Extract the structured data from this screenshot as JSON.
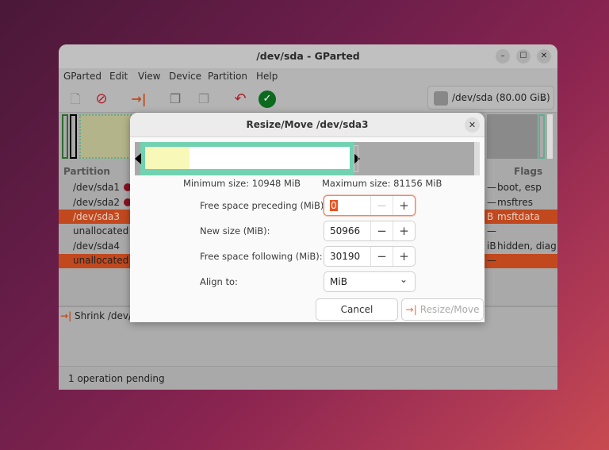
{
  "window": {
    "title": "/dev/sda - GParted",
    "controls": [
      "–",
      "☐",
      "✕"
    ]
  },
  "menu": [
    "GParted",
    "Edit",
    "View",
    "Device",
    "Partition",
    "Help"
  ],
  "toolbar": {
    "icons": [
      "new-partition-icon",
      "delete-icon",
      "resize-move-icon",
      "copy-icon",
      "paste-icon",
      "undo-icon",
      "apply-icon"
    ]
  },
  "device_selector": {
    "value": "/dev/sda (80.00 GiB)"
  },
  "table": {
    "headers": {
      "partition": "Partition",
      "flags": "Flags"
    },
    "rows": [
      {
        "partition": "/dev/sda1",
        "size_tail": "—",
        "flags": "boot, esp"
      },
      {
        "partition": "/dev/sda2",
        "size_tail": "—",
        "flags": "msftres"
      },
      {
        "partition": "/dev/sda3",
        "size_tail": "B",
        "flags": "msftdata",
        "selected": true
      },
      {
        "partition": "unallocated",
        "size_tail": "—",
        "flags": ""
      },
      {
        "partition": "/dev/sda4",
        "size_tail": "iB",
        "flags": "hidden, diag"
      },
      {
        "partition": "unallocated",
        "size_tail": "—",
        "flags": ""
      }
    ]
  },
  "operations": [
    "Shrink /dev/s"
  ],
  "status": "1 operation pending",
  "dialog": {
    "title": "Resize/Move /dev/sda3",
    "min_size": "Minimum size: 10948 MiB",
    "max_size": "Maximum size: 81156 MiB",
    "fields": [
      {
        "label": "Free space preceding (MiB):",
        "value": "0",
        "focused": true
      },
      {
        "label": "New size (MiB):",
        "value": "50966"
      },
      {
        "label": "Free space following (MiB):",
        "value": "30190"
      }
    ],
    "align": {
      "label": "Align to:",
      "value": "MiB"
    },
    "cancel": "Cancel",
    "resize": "Resize/Move",
    "colors": {
      "partition_border": "#70d2b0",
      "used": "#f8f8b8",
      "unallocated": "#a9a9a9",
      "accent": "#e95420"
    }
  }
}
